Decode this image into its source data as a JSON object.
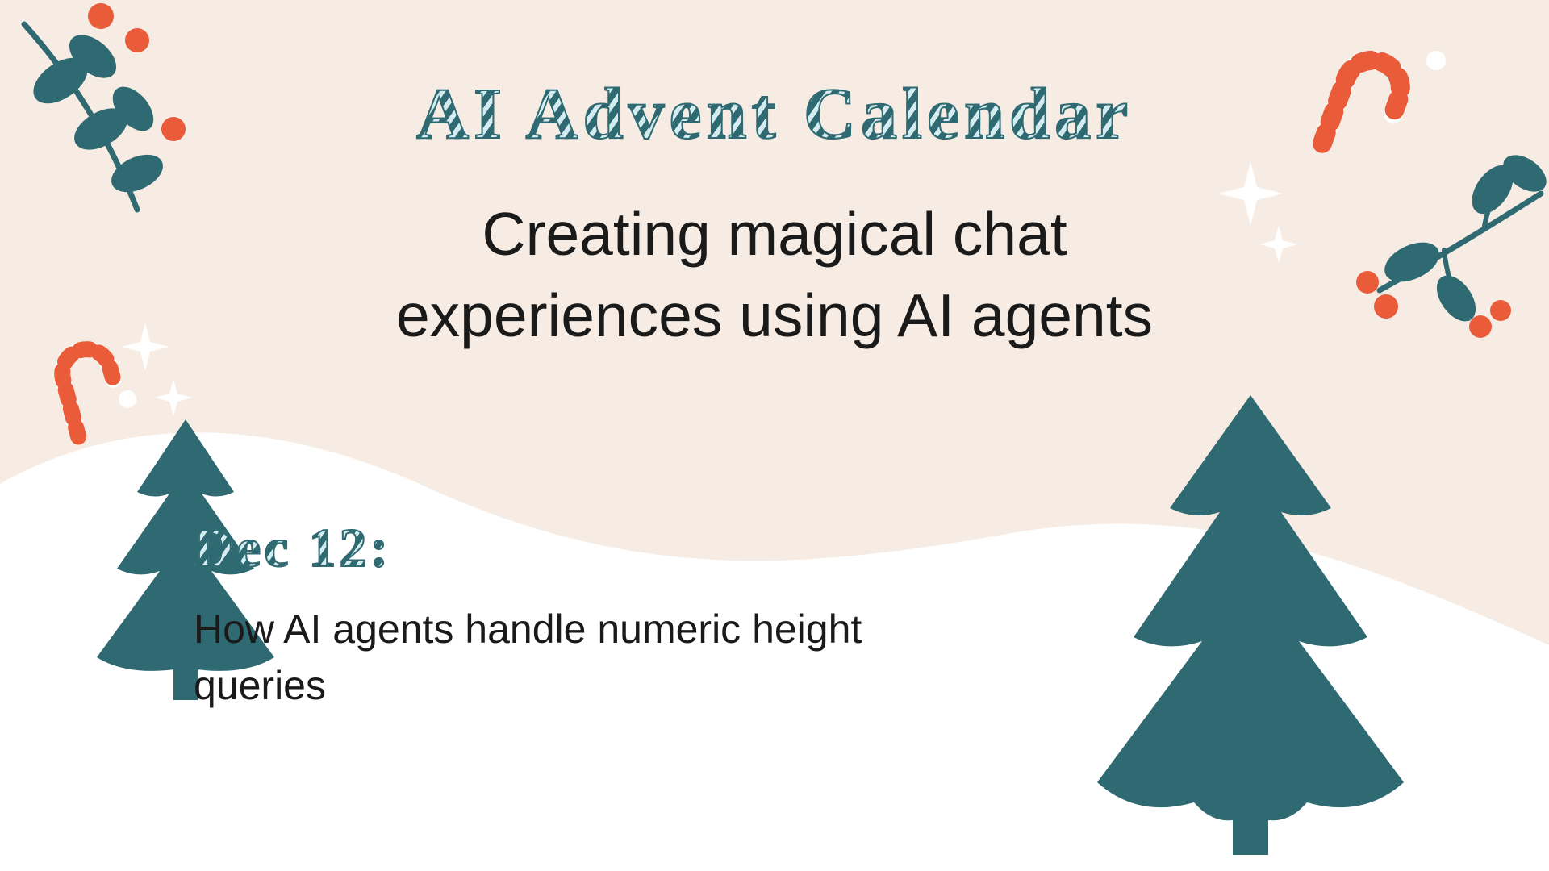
{
  "header": {
    "title": "AI Advent Calendar",
    "subtitle_line1": "Creating magical chat",
    "subtitle_line2": "experiences using AI agents"
  },
  "entry": {
    "date_label": "Dec 12:",
    "topic": "How AI agents handle numeric height queries"
  },
  "palette": {
    "teal": "#2f6a73",
    "cream": "#f6ece3",
    "orange": "#ea5b3a",
    "white": "#ffffff"
  }
}
